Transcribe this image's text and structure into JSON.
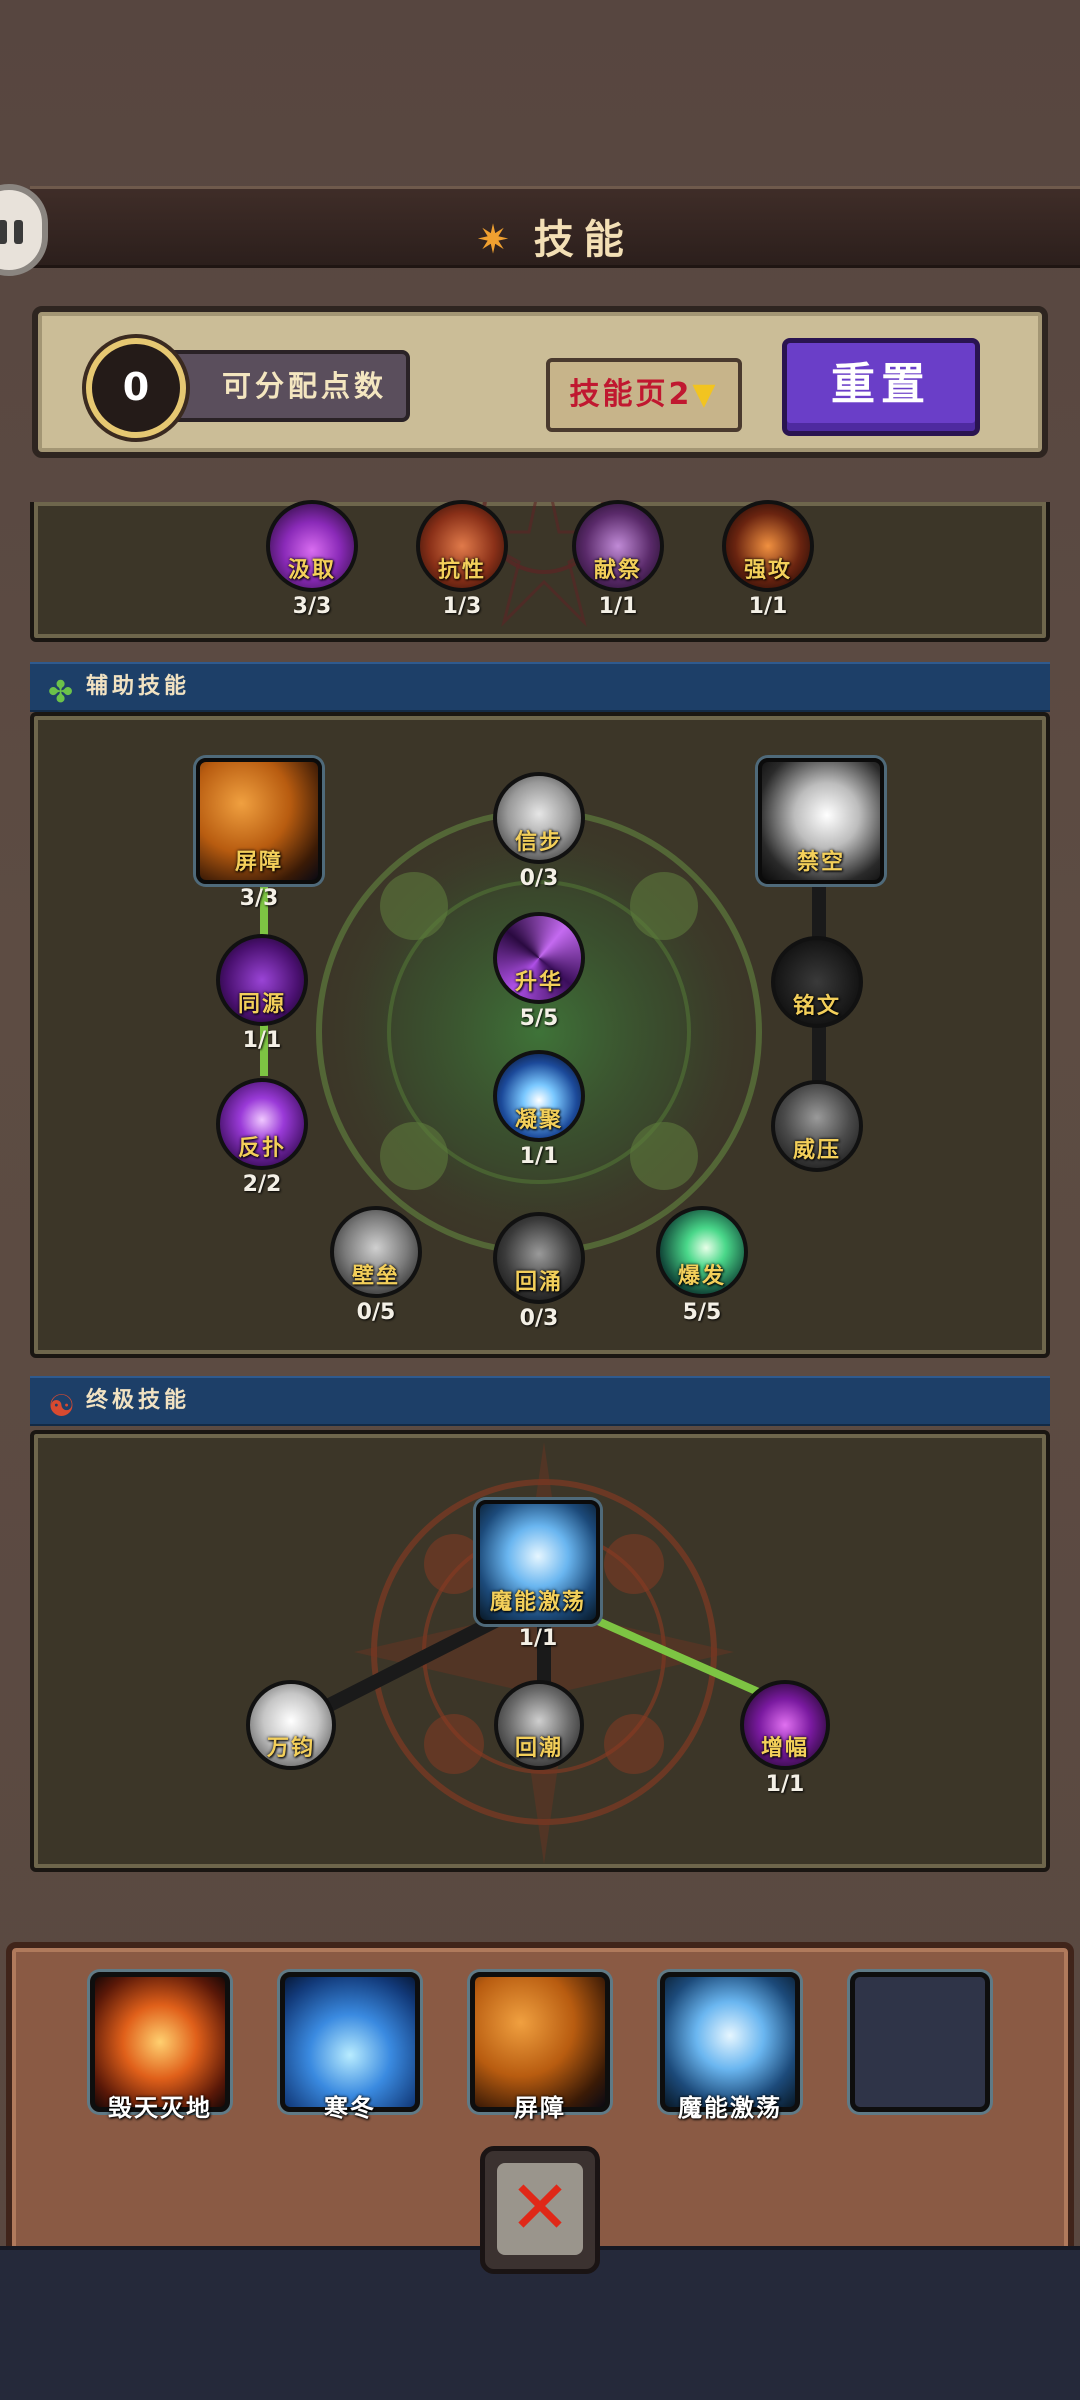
{
  "title": "技能",
  "points": {
    "value": "0",
    "label": "可分配点数"
  },
  "page_selector": {
    "label": "技能页2",
    "arrow": "▼"
  },
  "reset_label": "重置",
  "top_skills": [
    {
      "name": "汲取",
      "level": "3/3",
      "icon": "potion-icon"
    },
    {
      "name": "抗性",
      "level": "1/3",
      "icon": "shield-icon"
    },
    {
      "name": "献祭",
      "level": "1/1",
      "icon": "hand-icon"
    },
    {
      "name": "强攻",
      "level": "1/1",
      "icon": "claw-icon"
    }
  ],
  "support_section": {
    "title": "辅助技能",
    "icon": "clover-icon",
    "skills": [
      {
        "name": "屏障",
        "level": "3/3",
        "icon": "barrier-icon"
      },
      {
        "name": "信步",
        "level": "0/3",
        "icon": "boot-icon"
      },
      {
        "name": "禁空",
        "level": "",
        "icon": "bullet-icon"
      },
      {
        "name": "同源",
        "level": "1/1",
        "icon": "cross-icon"
      },
      {
        "name": "升华",
        "level": "5/5",
        "icon": "swirl-icon"
      },
      {
        "name": "铭文",
        "level": "",
        "icon": "rune-icon"
      },
      {
        "name": "反扑",
        "level": "2/2",
        "icon": "lightning-icon"
      },
      {
        "name": "凝聚",
        "level": "1/1",
        "icon": "spark-icon"
      },
      {
        "name": "威压",
        "level": "",
        "icon": "armor-icon"
      },
      {
        "name": "壁垒",
        "level": "0/5",
        "icon": "tower-shield-icon"
      },
      {
        "name": "回涌",
        "level": "0/3",
        "icon": "fist-icon"
      },
      {
        "name": "爆发",
        "level": "5/5",
        "icon": "burst-icon"
      }
    ]
  },
  "ultimate_section": {
    "title": "终极技能",
    "icon": "yin-yang-icon",
    "skills": [
      {
        "name": "魔能激荡",
        "level": "1/1",
        "icon": "wizard-icon"
      },
      {
        "name": "万钧",
        "level": "",
        "icon": "gauntlet-icon"
      },
      {
        "name": "回潮",
        "level": "",
        "icon": "wave-icon"
      },
      {
        "name": "增幅",
        "level": "1/1",
        "icon": "hammer-icon"
      }
    ]
  },
  "equipped": [
    {
      "label": "毁天灭地",
      "icon": "torch-icon"
    },
    {
      "label": "寒冬",
      "icon": "ice-icon"
    },
    {
      "label": "屏障",
      "icon": "barrier-icon"
    },
    {
      "label": "魔能激荡",
      "icon": "wizard-icon"
    },
    {
      "label": "",
      "icon": "empty-slot"
    }
  ],
  "close_symbol": "✕",
  "colors": {
    "accent_purple": "#6a3ec8",
    "link_active": "#7dc443",
    "link_inactive": "#1a1a1a",
    "skill_name": "#f3cf5a",
    "section_header": "#1d3f68"
  }
}
